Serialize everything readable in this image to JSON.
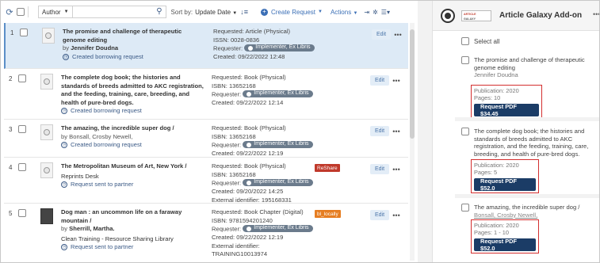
{
  "toolbar": {
    "author_label": "Author",
    "search_placeholder": "",
    "sort_label": "Sort by:",
    "sort_value": "Update Date",
    "create_request": "Create Request",
    "actions": "Actions"
  },
  "rows": [
    {
      "num": "1",
      "title": "The promise and challenge of therapeutic genome editing",
      "by_prefix": "by",
      "author": "Jennifer Doudna",
      "status": "Created borrowing request",
      "req_type": "Requested: Article (Physical)",
      "issn": "ISSN: 0028-0836",
      "requester_label": "Requester:",
      "requester": "Implementer, Ex Libris",
      "created": "Created: 09/22/2022 12:48",
      "edit": "Edit"
    },
    {
      "num": "2",
      "title": "The complete dog book; the histories and standards of breeds admitted to AKC registration, and the feeding, training, care, breeding, and health of pure-bred dogs.",
      "status": "Created borrowing request",
      "req_type": "Requested: Book (Physical)",
      "isbn": "ISBN: 13652168",
      "requester_label": "Requester:",
      "requester": "Implementer, Ex Libris",
      "created": "Created: 09/22/2022 12:14",
      "edit": "Edit"
    },
    {
      "num": "3",
      "title": "The amazing, the incredible super dog /",
      "by_prefix": "by",
      "author": "Bonsall, Crosby Newell,",
      "status": "Created borrowing request",
      "req_type": "Requested: Book (Physical)",
      "isbn": "ISBN: 13652168",
      "requester_label": "Requester:",
      "requester": "Implementer, Ex Libris",
      "created": "Created: 09/22/2022 12:19",
      "edit": "Edit"
    },
    {
      "num": "4",
      "title": "The Metropolitan Museum of Art, New York /",
      "library": "Reprints Desk",
      "status": "Request sent to partner",
      "req_type": "Requested: Book (Physical)",
      "isbn": "ISBN: 13652168",
      "requester_label": "Requester:",
      "requester": "Implementer, Ex Libris",
      "created": "Created: 09/20/2022 14:25",
      "external": "External identifier: 195168331",
      "tag": "ReShare",
      "edit": "Edit"
    },
    {
      "num": "5",
      "title": "Dog man : an uncommon life on a faraway mountain /",
      "by_prefix": "by",
      "author": "Sherrill, Martha.",
      "library": "Clean Training - Resource Sharing Library",
      "status": "Request sent to partner",
      "req_type": "Requested: Book Chapter (Digital)",
      "isbn": "ISBN: 9781594201240",
      "requester_label": "Requester:",
      "requester": "Implementer, Ex Libris",
      "created": "Created: 09/22/2022 12:19",
      "external": "External identifier:",
      "external2": "TRAINING10013974",
      "tag": "bl_locally",
      "edit": "Edit"
    }
  ],
  "addon": {
    "brand_top": "ARTICLE",
    "brand_bottom": "GALAXY",
    "title": "Article Galaxy Add-on",
    "select_all": "Select all",
    "items": [
      {
        "title": "The promise and challenge of therapeutic genome editing",
        "author": "Jennifer Doudna",
        "publication": "Publication: 2020",
        "pages": "Pages: 10",
        "button": "Request PDF $34.45"
      },
      {
        "title": "The complete dog book; the histories and standards of breeds admitted to AKC registration, and the feeding, training, care, breeding, and health of pure-bred dogs.",
        "publication": "Publication: 2020",
        "pages": "Pages: 5",
        "button": "Request PDF $52.0"
      },
      {
        "title": "The amazing, the incredible super dog /",
        "author": "Bonsall, Crosby Newell,",
        "publication": "Publication: 2020",
        "pages": "Pages: 1 - 10",
        "button": "Request PDF $52.0"
      }
    ]
  }
}
